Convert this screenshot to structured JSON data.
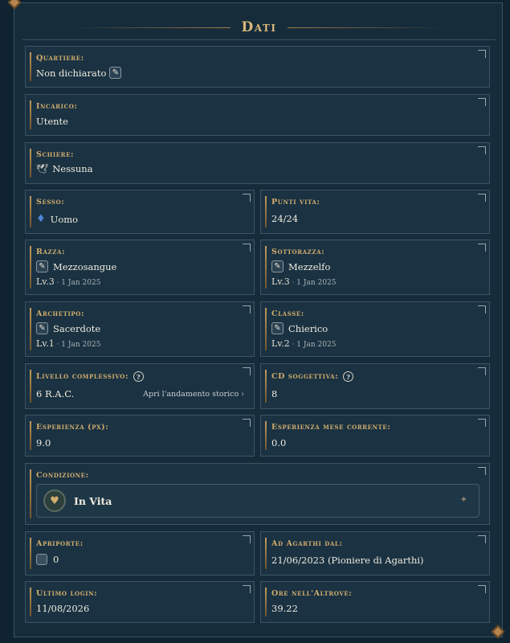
{
  "title": "Dati",
  "quartiere": {
    "label": "Quartiere:",
    "value": "Non dichiarato"
  },
  "incarico": {
    "label": "Incarico:",
    "value": "Utente"
  },
  "schiere": {
    "label": "Schiere:",
    "value": "Nessuna"
  },
  "sesso": {
    "label": "Sesso:",
    "value": "Uomo"
  },
  "punti_vita": {
    "label": "Punti vita:",
    "value": "24/24"
  },
  "razza": {
    "label": "Razza:",
    "value": "Mezzosangue",
    "level": "Lv.3",
    "date": " · 1 Jan 2025"
  },
  "sottorazza": {
    "label": "Sottorazza:",
    "value": "Mezzelfo",
    "level": "Lv.3",
    "date": " · 1 Jan 2025"
  },
  "archetipo": {
    "label": "Archetipo:",
    "value": "Sacerdote",
    "level": "Lv.1",
    "date": " · 1 Jan 2025"
  },
  "classe": {
    "label": "Classe:",
    "value": "Chierico",
    "level": "Lv.2",
    "date": " · 1 Jan 2025"
  },
  "livello": {
    "label": "Livello complessivo:",
    "value": "6 R.A.C.",
    "link": "Apri l'andamento storico ›"
  },
  "cd": {
    "label": "CD soggettiva:",
    "value": "8"
  },
  "esperienza": {
    "label": "Esperienza (px):",
    "value": "9.0"
  },
  "esperienza_mese": {
    "label": "Esperienza mese corrente:",
    "value": "0.0"
  },
  "condizione": {
    "label": "Condizione:",
    "value": "In Vita"
  },
  "apriporte": {
    "label": "Apriporte:",
    "value": "0"
  },
  "agarthi": {
    "label": "Ad Agarthi dal:",
    "value": "21/06/2023 (Pioniere di Agarthi)"
  },
  "login": {
    "label": "Ultimo login:",
    "value": "11/08/2026"
  },
  "ore": {
    "label": "Ore nell'Altrove:",
    "value": "39.22"
  },
  "icons": {
    "edit": "pencil-icon",
    "help": "question-icon",
    "gender": "gem-icon",
    "schiere": "bird-icon",
    "condition": "heart-icon"
  }
}
